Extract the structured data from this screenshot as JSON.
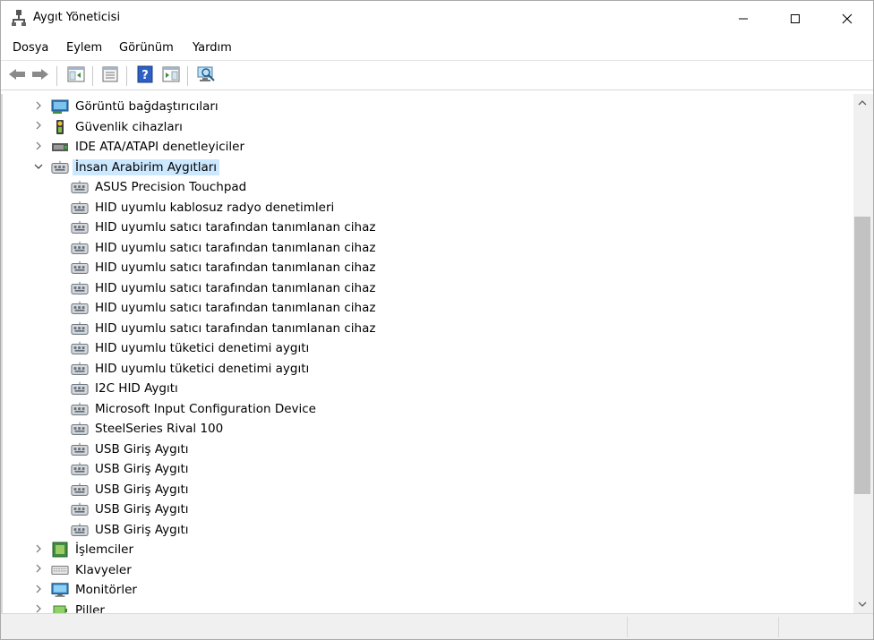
{
  "window": {
    "title": "Aygıt Yöneticisi"
  },
  "menu": {
    "items": [
      "Dosya",
      "Eylem",
      "Görünüm",
      "Yardım"
    ]
  },
  "toolbar": {
    "buttons": [
      "back-icon",
      "forward-icon",
      "show-hide-tree-icon",
      "properties-icon",
      "help-icon",
      "action-pane-icon",
      "scan-hardware-icon"
    ]
  },
  "tree": {
    "categories_before": [
      {
        "label": "Görüntü bağdaştırıcıları",
        "icon": "display-adapter-icon",
        "expanded": false
      },
      {
        "label": "Güvenlik cihazları",
        "icon": "security-device-icon",
        "expanded": false
      },
      {
        "label": "IDE ATA/ATAPI denetleyiciler",
        "icon": "ide-controller-icon",
        "expanded": false
      }
    ],
    "expanded_category": {
      "label": "İnsan Arabirim Aygıtları",
      "icon": "hid-icon",
      "expanded": true
    },
    "children": [
      "ASUS Precision Touchpad",
      "HID uyumlu kablosuz radyo denetimleri",
      "HID uyumlu satıcı tarafından tanımlanan cihaz",
      "HID uyumlu satıcı tarafından tanımlanan cihaz",
      "HID uyumlu satıcı tarafından tanımlanan cihaz",
      "HID uyumlu satıcı tarafından tanımlanan cihaz",
      "HID uyumlu satıcı tarafından tanımlanan cihaz",
      "HID uyumlu satıcı tarafından tanımlanan cihaz",
      "HID uyumlu tüketici denetimi aygıtı",
      "HID uyumlu tüketici denetimi aygıtı",
      "I2C HID Aygıtı",
      "Microsoft Input Configuration Device",
      "SteelSeries Rival 100",
      "USB Giriş Aygıtı",
      "USB Giriş Aygıtı",
      "USB Giriş Aygıtı",
      "USB Giriş Aygıtı",
      "USB Giriş Aygıtı"
    ],
    "categories_after": [
      {
        "label": "İşlemciler",
        "icon": "processor-icon",
        "expanded": false
      },
      {
        "label": "Klavyeler",
        "icon": "keyboard-icon",
        "expanded": false
      },
      {
        "label": "Monitörler",
        "icon": "monitor-icon",
        "expanded": false
      },
      {
        "label": "Piller",
        "icon": "battery-icon",
        "expanded": false
      }
    ]
  },
  "colors": {
    "selection": "#cce8ff",
    "scroll_thumb": "#c2c2c2",
    "statusbar": "#f0f0f0"
  }
}
